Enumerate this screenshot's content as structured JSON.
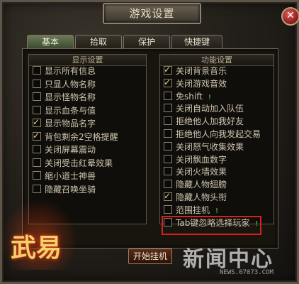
{
  "window": {
    "title": "游戏设置",
    "close_glyph": "✕"
  },
  "tabs": [
    {
      "label": "基本",
      "active": true
    },
    {
      "label": "拾取",
      "active": false
    },
    {
      "label": "保护",
      "active": false
    },
    {
      "label": "快捷键",
      "active": false
    }
  ],
  "display_settings": {
    "header": "显示设置",
    "items": [
      {
        "label": "显示所有信息",
        "checked": false
      },
      {
        "label": "只显人物名称",
        "checked": false
      },
      {
        "label": "显示怪物名称",
        "checked": false
      },
      {
        "label": "显示血条与值",
        "checked": false
      },
      {
        "label": "显示物品名字",
        "checked": true
      },
      {
        "label": "背包剩余2空格提醒",
        "checked": true
      },
      {
        "label": "关闭屏幕震动",
        "checked": false
      },
      {
        "label": "关闭受击红晕效果",
        "checked": false
      },
      {
        "label": "缩小道士神兽",
        "checked": false
      },
      {
        "label": "隐藏召唤坐骑",
        "checked": false
      }
    ]
  },
  "function_settings": {
    "header": "功能设置",
    "items": [
      {
        "label": "关闭背景音乐",
        "checked": true,
        "hint": ""
      },
      {
        "label": "关闭游戏音效",
        "checked": true,
        "hint": ""
      },
      {
        "label": "免shift",
        "checked": false,
        "hint": "!"
      },
      {
        "label": "关闭自动加入队伍",
        "checked": false,
        "hint": ""
      },
      {
        "label": "拒绝他人加我好友",
        "checked": false,
        "hint": ""
      },
      {
        "label": "拒绝他人向我发起交易",
        "checked": false,
        "hint": ""
      },
      {
        "label": "关闭怒气收集效果",
        "checked": false,
        "hint": ""
      },
      {
        "label": "关闭飘血数字",
        "checked": false,
        "hint": ""
      },
      {
        "label": "关闭火墙效果",
        "checked": false,
        "hint": ""
      },
      {
        "label": "隐藏人物翅膀",
        "checked": false,
        "hint": ""
      },
      {
        "label": "隐藏人物头衔",
        "checked": true,
        "hint": ""
      },
      {
        "label": "范围挂机",
        "checked": false,
        "hint": "!"
      },
      {
        "label": "Tab键忽略选择玩家",
        "checked": false,
        "hint": "!"
      }
    ]
  },
  "footer": {
    "start_button": "开始挂机"
  },
  "logo": {
    "text": "武易"
  },
  "watermark": {
    "main": "新闻中心",
    "sub": "NEWS.07073.COM"
  },
  "colors": {
    "highlight": "#d8201c",
    "hint_green": "#6cd36c",
    "check_gold": "#f0d080"
  }
}
